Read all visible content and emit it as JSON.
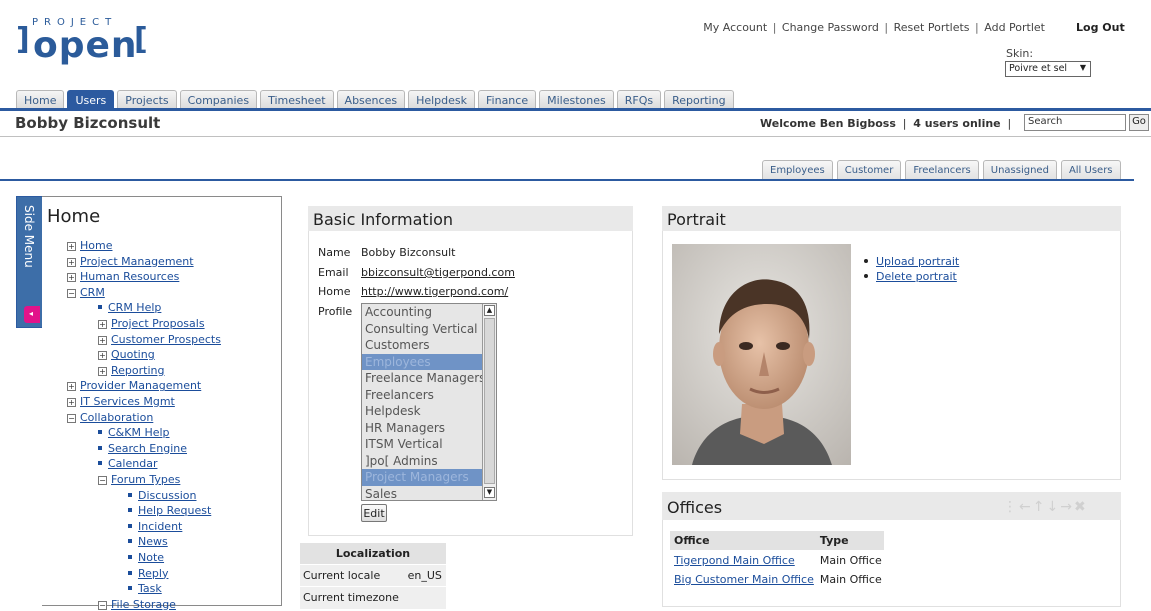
{
  "logo": {
    "top_text": "PROJECT",
    "word": "open",
    "bracket_left": "]",
    "bracket_right": "["
  },
  "header": {
    "links": [
      "My Account",
      "Change Password",
      "Reset Portlets",
      "Add Portlet"
    ],
    "separator": "|",
    "logout": "Log Out",
    "skin_label": "Skin:",
    "skin_value": "Poivre et sel"
  },
  "main_tabs": [
    "Home",
    "Users",
    "Projects",
    "Companies",
    "Timesheet",
    "Absences",
    "Helpdesk",
    "Finance",
    "Milestones",
    "RFQs",
    "Reporting"
  ],
  "active_tab": "Users",
  "page_title": "Bobby Bizconsult",
  "welcome": {
    "text": "Welcome Ben Bigboss",
    "online": "4 users online"
  },
  "search": {
    "placeholder": "Search",
    "go": "Go"
  },
  "user_tabs": [
    "Employees",
    "Customer",
    "Freelancers",
    "Unassigned",
    "All Users"
  ],
  "side_menu": {
    "tab_label": "Side Menu",
    "title": "Home",
    "items": [
      {
        "label": "Home",
        "kind": "plus"
      },
      {
        "label": "Project Management",
        "kind": "plus"
      },
      {
        "label": "Human Resources",
        "kind": "plus"
      },
      {
        "label": "CRM",
        "kind": "minus"
      },
      {
        "label": "CRM Help",
        "kind": "bullet"
      },
      {
        "label": "Project Proposals",
        "kind": "plus"
      },
      {
        "label": "Customer Prospects",
        "kind": "plus"
      },
      {
        "label": "Quoting",
        "kind": "plus"
      },
      {
        "label": "Reporting",
        "kind": "plus"
      },
      {
        "label": "Provider Management",
        "kind": "plus"
      },
      {
        "label": "IT Services Mgmt",
        "kind": "plus"
      },
      {
        "label": "Collaboration",
        "kind": "minus"
      },
      {
        "label": "C&KM Help",
        "kind": "bullet"
      },
      {
        "label": "Search Engine",
        "kind": "bullet"
      },
      {
        "label": "Calendar",
        "kind": "bullet"
      },
      {
        "label": "Forum Types",
        "kind": "minus"
      },
      {
        "label": "Discussion",
        "kind": "bullet"
      },
      {
        "label": "Help Request",
        "kind": "bullet"
      },
      {
        "label": "Incident",
        "kind": "bullet"
      },
      {
        "label": "News",
        "kind": "bullet"
      },
      {
        "label": "Note",
        "kind": "bullet"
      },
      {
        "label": "Reply",
        "kind": "bullet"
      },
      {
        "label": "Task",
        "kind": "bullet"
      },
      {
        "label": "File Storage",
        "kind": "minus"
      }
    ]
  },
  "basic_info": {
    "title": "Basic Information",
    "name_label": "Name",
    "name": "Bobby Bizconsult",
    "email_label": "Email",
    "email": "bbizconsult@tigerpond.com",
    "home_label": "Home",
    "home": "http://www.tigerpond.com/",
    "profile_label": "Profile",
    "profiles": [
      {
        "label": "Accounting",
        "selected": false
      },
      {
        "label": "Consulting Vertical",
        "selected": false
      },
      {
        "label": "Customers",
        "selected": false
      },
      {
        "label": "Employees",
        "selected": true
      },
      {
        "label": "Freelance Managers",
        "selected": false
      },
      {
        "label": "Freelancers",
        "selected": false
      },
      {
        "label": "Helpdesk",
        "selected": false
      },
      {
        "label": "HR Managers",
        "selected": false
      },
      {
        "label": "ITSM Vertical",
        "selected": false
      },
      {
        "label": "]po[ Admins",
        "selected": false
      },
      {
        "label": "Project Managers",
        "selected": true
      },
      {
        "label": "Sales",
        "selected": false
      }
    ],
    "edit_button": "Edit"
  },
  "localization": {
    "title": "Localization",
    "rows": [
      {
        "label": "Current locale",
        "value": "en_US"
      },
      {
        "label": "Current timezone",
        "value": ""
      }
    ]
  },
  "portrait": {
    "title": "Portrait",
    "links": [
      "Upload portrait",
      "Delete portrait"
    ]
  },
  "offices": {
    "title": "Offices",
    "headers": [
      "Office",
      "Type"
    ],
    "rows": [
      {
        "office": "Tigerpond Main Office",
        "type": "Main Office"
      },
      {
        "office": "Big Customer Main Office",
        "type": "Main Office"
      }
    ]
  },
  "colors": {
    "accent": "#2c5aa0",
    "link": "#1b4d9b",
    "badge": "#e2138a"
  }
}
